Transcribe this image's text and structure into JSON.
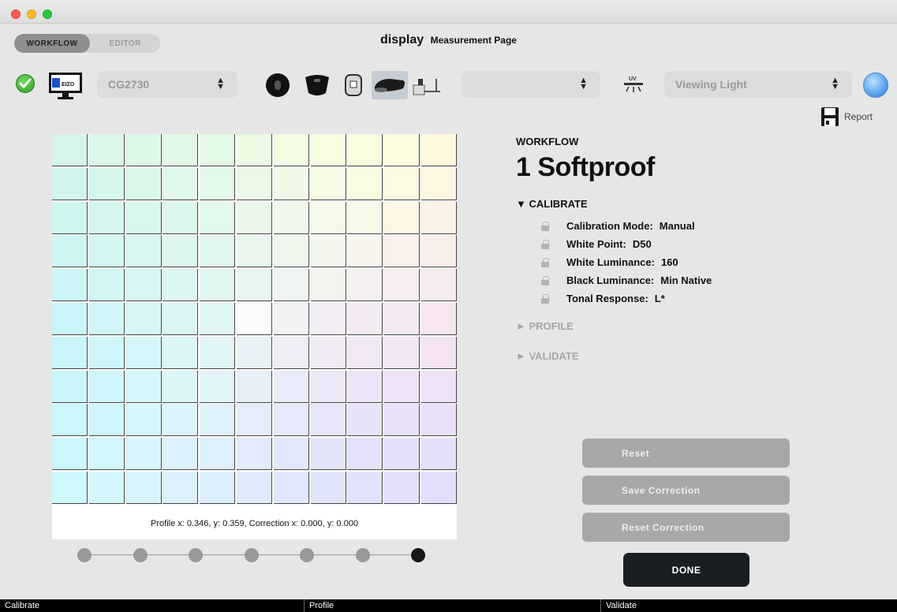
{
  "header": {
    "tabs": [
      {
        "label": "WORKFLOW",
        "active": true
      },
      {
        "label": "EDITOR",
        "active": false
      }
    ],
    "title_main": "display",
    "title_sub": "Measurement Page"
  },
  "toolbar": {
    "monitor_logo_text": "EIZO",
    "model_select": "CG2730",
    "middle_select": "",
    "uv_label": "UV",
    "light_select": "Viewing Light",
    "report_label": "Report",
    "devices": [
      "i1-display-icon",
      "colormunki-icon",
      "spyder-icon",
      "i1-pro-icon",
      "spectroradiometer-icon"
    ],
    "selected_device_index": 3
  },
  "patches": {
    "rows": [
      [
        "#d5f5ea",
        "#daf7e7",
        "#dcf8e6",
        "#e1f9e5",
        "#e5fae4",
        "#ecfbe3",
        "#f1fce2",
        "#f7fde1",
        "#fafde0",
        "#fdfde0",
        "#fef8de"
      ],
      [
        "#d1f5ee",
        "#d6f6eb",
        "#dbf7ea",
        "#e0f8e9",
        "#e5f9e8",
        "#ebf9e7",
        "#f0fae6",
        "#f6fbe5",
        "#f9fbe3",
        "#fcfae2",
        "#fdf6e1"
      ],
      [
        "#cff5f1",
        "#d4f6ef",
        "#d9f6ed",
        "#def7ec",
        "#e4f8eb",
        "#eaf8ea",
        "#f0f8ea",
        "#f5f9e8",
        "#f8f8e8",
        "#fbf6e6",
        "#fcf2e5"
      ],
      [
        "#cdf5f4",
        "#d3f6f2",
        "#d8f6f0",
        "#ddf7ef",
        "#e3f7ee",
        "#e9f7ee",
        "#eff7ed",
        "#f4f7ed",
        "#f7f5ec",
        "#f9f2eb",
        "#faeeea"
      ],
      [
        "#cbf5f6",
        "#d1f5f5",
        "#d6f5f3",
        "#dcf6f2",
        "#e2f6f2",
        "#e8f6f1",
        "#eff6f1",
        "#f3f4f0",
        "#f5f1f0",
        "#f7eeef",
        "#f8ebee"
      ],
      [
        "#caf5f8",
        "#d0f5f7",
        "#d5f5f6",
        "#dbf5f5",
        "#e2f5f5",
        "#fbfbfb",
        "#f2f2f4",
        "#f3eef3",
        "#f4ebf2",
        "#f5e9f2",
        "#f6e7f1"
      ],
      [
        "#c9f6fa",
        "#cff6f9",
        "#d5f6f8",
        "#dbf5f8",
        "#e2f4f7",
        "#e8f1f6",
        "#eeeef6",
        "#f0eaf5",
        "#f1e7f5",
        "#f2e5f4",
        "#f3e3f4"
      ],
      [
        "#c9f6fb",
        "#cff6fa",
        "#d5f6fa",
        "#dbf5f9",
        "#e2f3f9",
        "#e7eff8",
        "#eaebf8",
        "#ece8f7",
        "#ede5f7",
        "#eee3f6",
        "#efe1f6"
      ],
      [
        "#c9f7fc",
        "#cff7fb",
        "#d5f6fb",
        "#dbf4fb",
        "#e1f1fa",
        "#e4edf9",
        "#e6e9f9",
        "#e7e6f9",
        "#e8e3f9",
        "#e9e1f8",
        "#eae0f8"
      ],
      [
        "#cbf7fc",
        "#d1f7fc",
        "#d7f5fc",
        "#dcf2fc",
        "#dfeffb",
        "#e1ebfb",
        "#e2e8fb",
        "#e3e5fb",
        "#e4e2fa",
        "#e5e0fa",
        "#e6dffa"
      ],
      [
        "#cdf8fc",
        "#d3f7fc",
        "#d9f4fc",
        "#dcf1fc",
        "#ddeefc",
        "#deebfc",
        "#dfe8fc",
        "#e0e5fc",
        "#e1e2fb",
        "#e2e0fb",
        "#e3dffb"
      ]
    ],
    "coordinates_text": "Profile x: 0.346, y: 0.359, Correction x: 0.000, y: 0.000"
  },
  "stepper": {
    "count": 7,
    "active_index": 6
  },
  "workflow": {
    "label": "WORKFLOW",
    "title": "1 Softproof",
    "calibrate_header": "▼ CALIBRATE",
    "settings": [
      {
        "key": "Calibration Mode:",
        "value": "Manual"
      },
      {
        "key": "White Point:",
        "value": "D50"
      },
      {
        "key": "White Luminance:",
        "value": "160"
      },
      {
        "key": "Black Luminance:",
        "value": "Min Native"
      },
      {
        "key": "Tonal Response:",
        "value": "L*"
      }
    ],
    "profile_header": "► PROFILE",
    "validate_header": "► VALIDATE"
  },
  "buttons": {
    "reset": "Reset",
    "save_correction": "Save Correction",
    "reset_correction": "Reset Correction",
    "done": "DONE"
  },
  "bottom_bar": [
    "Calibrate",
    "Profile",
    "Validate"
  ],
  "colors": {
    "accent_dark": "#1a1d21",
    "button_disabled": "#a8a8a8",
    "background": "#e6e6e6"
  }
}
